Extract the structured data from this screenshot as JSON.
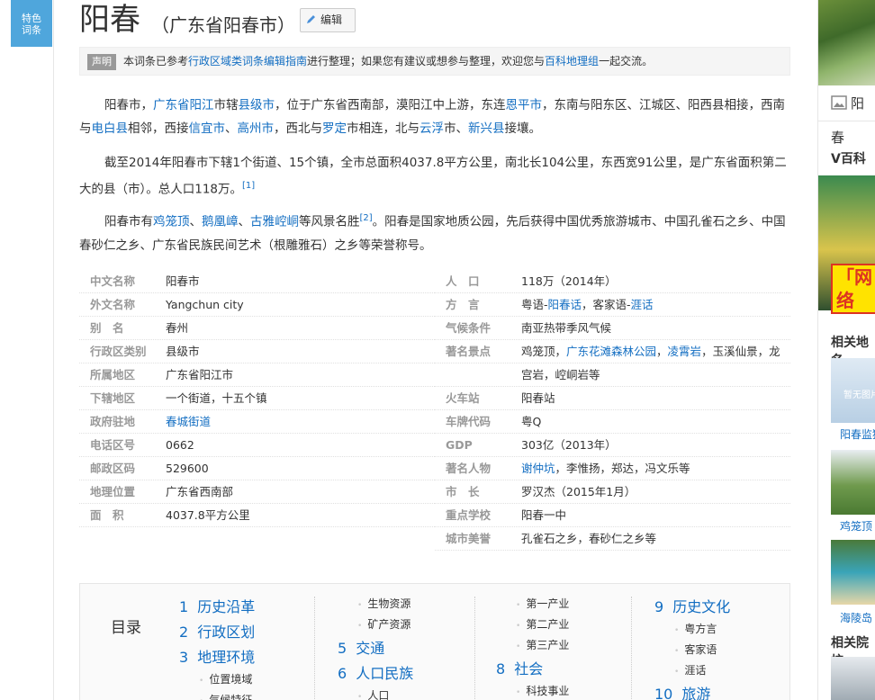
{
  "side_badge": {
    "line1": "特色",
    "line2": "词条"
  },
  "header": {
    "title": "阳春",
    "subtitle": "（广东省阳春市）",
    "edit_label": "编辑"
  },
  "notice": {
    "tag": "声明",
    "p1": "本词条已参考",
    "link1": "行政区域类词条编辑指南",
    "p2": "进行整理；如果您有建议或想参与整理，欢迎您与",
    "link2": "百科地理组",
    "p3": "一起交流。"
  },
  "intro": {
    "p1": [
      {
        "t": "阳春市，"
      },
      {
        "t": "广东省阳江",
        "link": true
      },
      {
        "t": "市辖"
      },
      {
        "t": "县级市",
        "link": true
      },
      {
        "t": "，位于广东省西南部，漠阳江中上游，东连"
      },
      {
        "t": "恩平市",
        "link": true
      },
      {
        "t": "，东南与阳东区、江城区、阳西县相接，西南与"
      },
      {
        "t": "电白县",
        "link": true
      },
      {
        "t": "相邻，西接"
      },
      {
        "t": "信宜市",
        "link": true
      },
      {
        "t": "、"
      },
      {
        "t": "高州市",
        "link": true
      },
      {
        "t": "，西北与"
      },
      {
        "t": "罗定",
        "link": true
      },
      {
        "t": "市相连，北与"
      },
      {
        "t": "云浮",
        "link": true
      },
      {
        "t": "市、"
      },
      {
        "t": "新兴县",
        "link": true
      },
      {
        "t": "接壤。"
      }
    ],
    "p2": [
      {
        "t": "截至2014年阳春市下辖1个街道、15个镇，全市总面积4037.8平方公里，南北长104公里，东西宽91公里，是广东省面积第二大的县（市）。总人口118万。"
      },
      {
        "t": "[1]",
        "sup": true
      }
    ],
    "p3": [
      {
        "t": "阳春市有"
      },
      {
        "t": "鸡笼顶",
        "link": true
      },
      {
        "t": "、"
      },
      {
        "t": "鹅凰嶂",
        "link": true
      },
      {
        "t": "、"
      },
      {
        "t": "古雅崆峒",
        "link": true
      },
      {
        "t": "等风景名胜"
      },
      {
        "t": "[2]",
        "sup": true
      },
      {
        "t": "。阳春是国家地质公园，先后获得中国优秀旅游城市、中国孔雀石之乡、中国春砂仁之乡、广东省民族民间艺术（根雕雅石）之乡等荣誉称号。"
      }
    ]
  },
  "basic_info": {
    "left": [
      {
        "k": "中文名称",
        "v": [
          {
            "t": "阳春市"
          }
        ]
      },
      {
        "k": "外文名称",
        "v": [
          {
            "t": "Yangchun city"
          }
        ]
      },
      {
        "k": "别　名",
        "v": [
          {
            "t": "春州"
          }
        ]
      },
      {
        "k": "行政区类别",
        "v": [
          {
            "t": "县级市"
          }
        ]
      },
      {
        "k": "所属地区",
        "v": [
          {
            "t": "广东省阳江市"
          }
        ]
      },
      {
        "k": "下辖地区",
        "v": [
          {
            "t": "一个街道，十五个镇"
          }
        ]
      },
      {
        "k": "政府驻地",
        "v": [
          {
            "t": "春城街道",
            "link": true
          }
        ]
      },
      {
        "k": "电话区号",
        "v": [
          {
            "t": "0662"
          }
        ]
      },
      {
        "k": "邮政区码",
        "v": [
          {
            "t": "529600"
          }
        ]
      },
      {
        "k": "地理位置",
        "v": [
          {
            "t": "广东省西南部"
          }
        ]
      },
      {
        "k": "面　积",
        "v": [
          {
            "t": "4037.8平方公里"
          }
        ]
      }
    ],
    "right": [
      {
        "k": "人　口",
        "v": [
          {
            "t": "118万（2014年）"
          }
        ]
      },
      {
        "k": "方　言",
        "v": [
          {
            "t": "粤语-"
          },
          {
            "t": "阳春话",
            "link": true
          },
          {
            "t": "，客家语-"
          },
          {
            "t": "涯话",
            "link": true
          }
        ]
      },
      {
        "k": "气候条件",
        "v": [
          {
            "t": "南亚热带季风气候"
          }
        ]
      },
      {
        "k": "著名景点",
        "v": [
          {
            "t": "鸡笼顶，"
          },
          {
            "t": "广东花滩森林公园",
            "link": true
          },
          {
            "t": "，"
          },
          {
            "t": "凌霄岩",
            "link": true
          },
          {
            "t": "，玉溪仙景，龙"
          }
        ]
      },
      {
        "k": "",
        "v": [
          {
            "t": "宫岩，崆峒岩等"
          }
        ]
      },
      {
        "k": "火车站",
        "v": [
          {
            "t": "阳春站"
          }
        ]
      },
      {
        "k": "车牌代码",
        "v": [
          {
            "t": "粤Q"
          }
        ]
      },
      {
        "k": "GDP",
        "v": [
          {
            "t": "303亿（2013年）"
          }
        ]
      },
      {
        "k": "著名人物",
        "v": [
          {
            "t": "谢仲坑",
            "link": true
          },
          {
            "t": "，李惟扬，郑达，冯文乐等"
          }
        ]
      },
      {
        "k": "市　长",
        "v": [
          {
            "t": "罗汉杰（2015年1月）"
          }
        ]
      },
      {
        "k": "重点学校",
        "v": [
          {
            "t": "阳春一中"
          }
        ]
      },
      {
        "k": "城市美誉",
        "v": [
          {
            "t": "孔雀石之乡，春砂仁之乡等"
          }
        ]
      }
    ]
  },
  "toc": {
    "label": "目录",
    "columns": [
      [
        {
          "type": "h",
          "n": "1",
          "t": "历史沿革"
        },
        {
          "type": "h",
          "n": "2",
          "t": "行政区划"
        },
        {
          "type": "h",
          "n": "3",
          "t": "地理环境"
        },
        {
          "type": "s",
          "t": "位置境域"
        },
        {
          "type": "s",
          "t": "气候特征"
        }
      ],
      [
        {
          "type": "s",
          "t": "生物资源"
        },
        {
          "type": "s",
          "t": "矿产资源"
        },
        {
          "type": "h",
          "n": "5",
          "t": "交通"
        },
        {
          "type": "h",
          "n": "6",
          "t": "人口民族"
        },
        {
          "type": "s",
          "t": "人口"
        }
      ],
      [
        {
          "type": "s",
          "t": "第一产业"
        },
        {
          "type": "s",
          "t": "第二产业"
        },
        {
          "type": "s",
          "t": "第三产业"
        },
        {
          "type": "h",
          "n": "8",
          "t": "社会"
        },
        {
          "type": "s",
          "t": "科技事业"
        }
      ],
      [
        {
          "type": "h",
          "n": "9",
          "t": "历史文化"
        },
        {
          "type": "s",
          "t": "粤方言"
        },
        {
          "type": "s",
          "t": "客家语"
        },
        {
          "type": "s",
          "t": "涯话"
        },
        {
          "type": "h",
          "n": "10",
          "t": "旅游"
        }
      ]
    ]
  },
  "right_rail": {
    "image_caption": "阳春",
    "vbaike_title": "V百科",
    "vbaike_banner": "「网络",
    "related_places_title": "相关地名",
    "thumb1_overlay": "暂无图片",
    "thumb1_caption": "阳春监狱",
    "thumb2_caption": "鸡笼顶",
    "thumb3_caption": "海陵岛",
    "related_schools_title": "相关院校"
  }
}
